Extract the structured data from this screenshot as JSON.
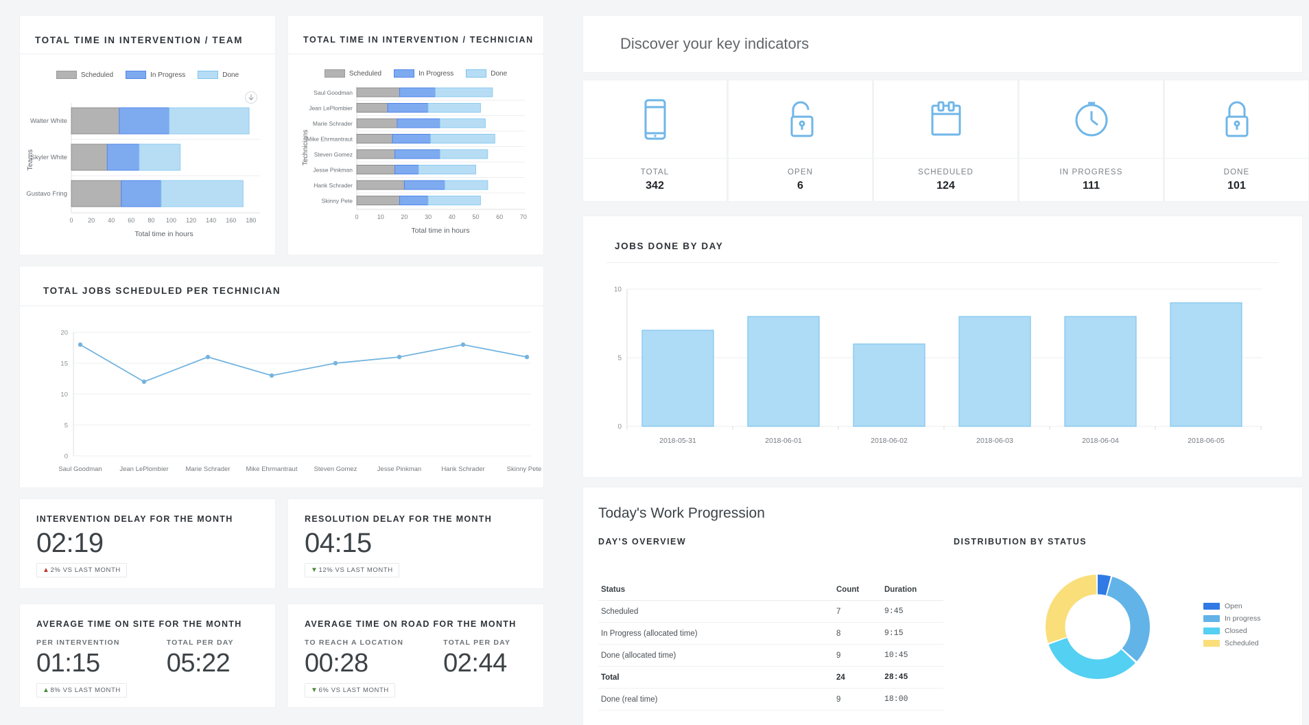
{
  "left": {
    "team_chart": {
      "title": "TOTAL TIME IN INTERVENTION / TEAM",
      "legend": [
        "Scheduled",
        "In Progress",
        "Done"
      ],
      "y_axis_label": "Teams",
      "x_axis_label": "Total time in hours",
      "x_ticks": [
        "0",
        "20",
        "40",
        "60",
        "80",
        "100",
        "120",
        "140",
        "160",
        "180"
      ],
      "download_icon": "download-icon"
    },
    "tech_chart": {
      "title": "TOTAL TIME IN INTERVENTION / TECHNICIAN",
      "legend": [
        "Scheduled",
        "In Progress",
        "Done"
      ],
      "y_axis_label": "Technicians",
      "x_axis_label": "Total time in hours",
      "x_ticks": [
        "0",
        "10",
        "20",
        "30",
        "40",
        "50",
        "60",
        "70"
      ]
    },
    "line_chart": {
      "title": "TOTAL JOBS SCHEDULED PER TECHNICIAN"
    },
    "metrics": [
      {
        "head": "INTERVENTION DELAY FOR THE MONTH",
        "value": "02:19",
        "delta_dir": "up",
        "delta_good": false,
        "delta": "2% VS LAST MONTH"
      },
      {
        "head": "RESOLUTION DELAY FOR THE MONTH",
        "value": "04:15",
        "delta_dir": "down",
        "delta_good": true,
        "delta": "12% VS LAST MONTH"
      }
    ],
    "metrics2": [
      {
        "head": "AVERAGE TIME ON SITE FOR THE MONTH",
        "sub1": "PER INTERVENTION",
        "val1": "01:15",
        "sub2": "TOTAL PER DAY",
        "val2": "05:22",
        "delta_dir": "up",
        "delta_good": true,
        "delta": "8% VS LAST MONTH"
      },
      {
        "head": "AVERAGE TIME ON ROAD FOR THE MONTH",
        "sub1": "TO REACH A LOCATION",
        "val1": "00:28",
        "sub2": "TOTAL PER DAY",
        "val2": "02:44",
        "delta_dir": "down",
        "delta_good": true,
        "delta": "6% VS LAST MONTH"
      }
    ]
  },
  "right": {
    "header_title": "Discover your key indicators",
    "kpis": [
      {
        "icon": "mobile-icon",
        "label": "TOTAL",
        "value": "342"
      },
      {
        "icon": "unlock-icon",
        "label": "OPEN",
        "value": "6"
      },
      {
        "icon": "calendar-icon",
        "label": "SCHEDULED",
        "value": "124"
      },
      {
        "icon": "clock-icon",
        "label": "IN PROGRESS",
        "value": "111"
      },
      {
        "icon": "lock-icon",
        "label": "DONE",
        "value": "101"
      }
    ],
    "jobs_card_title": "JOBS DONE BY DAY",
    "progression": {
      "title": "Today's Work Progression",
      "overview_title": "DAY'S OVERVIEW",
      "distribution_title": "DISTRIBUTION BY STATUS",
      "table": {
        "headers": [
          "Status",
          "Count",
          "Duration"
        ],
        "rows": [
          {
            "status": "Scheduled",
            "count": "7",
            "duration": "9:45",
            "total": false
          },
          {
            "status": "In Progress (allocated time)",
            "count": "8",
            "duration": "9:15",
            "total": false
          },
          {
            "status": "Done (allocated time)",
            "count": "9",
            "duration": "10:45",
            "total": false
          },
          {
            "status": "Total",
            "count": "24",
            "duration": "28:45",
            "total": true
          },
          {
            "status": "Done (real time)",
            "count": "9",
            "duration": "18:00",
            "total": false
          }
        ]
      }
    }
  },
  "colors": {
    "scheduled": "#b3b3b3",
    "in_progress": "#7eaaf0",
    "done": "#b7ddf5",
    "accent": "#6fb6e8",
    "donut_open": "#2f7ae5",
    "donut_inprogress": "#62b3e8",
    "donut_closed": "#53d0f2",
    "donut_scheduled": "#fade7a"
  },
  "chart_data": [
    {
      "type": "bar",
      "orientation": "horizontal",
      "stacked": true,
      "title": "TOTAL TIME IN INTERVENTION / TEAM",
      "xlabel": "Total time in hours",
      "ylabel": "Teams",
      "xlim": [
        0,
        180
      ],
      "grid": true,
      "legend": [
        "Scheduled",
        "In Progress",
        "Done"
      ],
      "categories": [
        "Walter White",
        "Skyler White",
        "Gustavo Fring"
      ],
      "series": [
        {
          "name": "Scheduled",
          "values": [
            48,
            36,
            50
          ]
        },
        {
          "name": "In Progress",
          "values": [
            50,
            32,
            40
          ]
        },
        {
          "name": "Done",
          "values": [
            80,
            41,
            82
          ]
        }
      ]
    },
    {
      "type": "bar",
      "orientation": "horizontal",
      "stacked": true,
      "title": "TOTAL TIME IN INTERVENTION / TECHNICIAN",
      "xlabel": "Total time in hours",
      "ylabel": "Technicians",
      "xlim": [
        0,
        70
      ],
      "grid": true,
      "legend": [
        "Scheduled",
        "In Progress",
        "Done"
      ],
      "categories": [
        "Saul Goodman",
        "Jean LePlombier",
        "Marie Schrader",
        "Mike Ehrmantraut",
        "Steven Gomez",
        "Jesse Pinkman",
        "Hank Schrader",
        "Skinny Pete"
      ],
      "series": [
        {
          "name": "Scheduled",
          "values": [
            18,
            13,
            17,
            15,
            16,
            16,
            20,
            18
          ]
        },
        {
          "name": "In Progress",
          "values": [
            15,
            17,
            18,
            16,
            19,
            10,
            17,
            12
          ]
        },
        {
          "name": "Done",
          "values": [
            24,
            22,
            19,
            27,
            20,
            24,
            18,
            22
          ]
        }
      ]
    },
    {
      "type": "line",
      "title": "TOTAL JOBS SCHEDULED PER TECHNICIAN",
      "xlabel": "",
      "ylabel": "",
      "ylim": [
        0,
        20
      ],
      "yticks": [
        0,
        5,
        10,
        15,
        20
      ],
      "grid": true,
      "categories": [
        "Saul Goodman",
        "Jean LePlombier",
        "Marie Schrader",
        "Mike Ehrmantraut",
        "Steven Gomez",
        "Jesse Pinkman",
        "Hank Schrader",
        "Skinny Pete"
      ],
      "values": [
        18,
        12,
        16,
        13,
        15,
        16,
        18,
        16
      ]
    },
    {
      "type": "bar",
      "orientation": "vertical",
      "title": "JOBS DONE BY DAY",
      "xlabel": "",
      "ylabel": "",
      "ylim": [
        0,
        10
      ],
      "yticks": [
        0,
        5,
        10
      ],
      "grid": true,
      "categories": [
        "2018-05-31",
        "2018-06-01",
        "2018-06-02",
        "2018-06-03",
        "2018-06-04",
        "2018-06-05"
      ],
      "values": [
        7,
        8,
        6,
        8,
        8,
        9
      ]
    },
    {
      "type": "pie",
      "variant": "donut",
      "title": "DISTRIBUTION BY STATUS",
      "legend_position": "right",
      "labels": [
        "Open",
        "In progress",
        "Closed",
        "Scheduled"
      ],
      "values": [
        4,
        30,
        36,
        30
      ],
      "colors": [
        "#2f7ae5",
        "#62b3e8",
        "#53d0f2",
        "#fade7a"
      ]
    },
    {
      "type": "table",
      "title": "DAY'S OVERVIEW",
      "columns": [
        "Status",
        "Count",
        "Duration"
      ],
      "rows": [
        [
          "Scheduled",
          "7",
          "9:45"
        ],
        [
          "In Progress (allocated time)",
          "8",
          "9:15"
        ],
        [
          "Done (allocated time)",
          "9",
          "10:45"
        ],
        [
          "Total",
          "24",
          "28:45"
        ],
        [
          "Done (real time)",
          "9",
          "18:00"
        ]
      ]
    }
  ]
}
